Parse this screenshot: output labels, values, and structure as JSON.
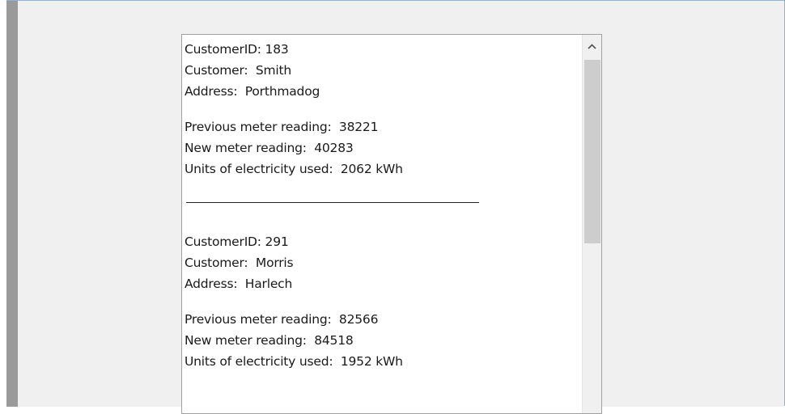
{
  "records": [
    {
      "customer_id_text": "CustomerID: 183",
      "customer_text": "Customer:  Smith",
      "address_text": "Address:  Porthmadog",
      "previous_reading_text": "Previous meter reading:  38221",
      "new_reading_text": "New meter reading:  40283",
      "units_used_text": "Units of electricity used:  2062 kWh"
    },
    {
      "customer_id_text": "CustomerID: 291",
      "customer_text": "Customer:  Morris",
      "address_text": "Address:  Harlech",
      "previous_reading_text": "Previous meter reading:  82566",
      "new_reading_text": "New meter reading:  84518",
      "units_used_text": "Units of electricity used:  1952 kWh"
    }
  ],
  "scrollbar": {
    "up_arrow_icon": "chevron-up-icon",
    "thumb_color": "#cdcdcd"
  },
  "colors": {
    "window_background": "#f0f0f0",
    "listbox_background": "#ffffff",
    "left_edge": "#9a9a9a",
    "frame_border": "#8fb3d9"
  }
}
